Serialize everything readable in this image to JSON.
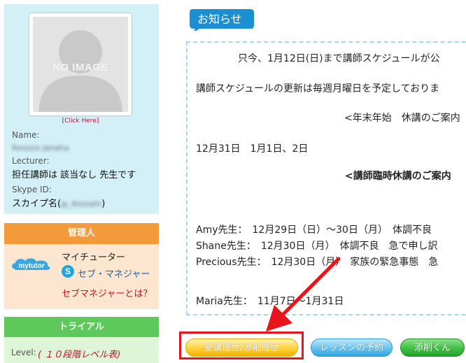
{
  "profile": {
    "noimage": "NO IMAGE",
    "click_here": "[Click Here]",
    "name_label": "Name:",
    "name_value": "Koozzis Janaha",
    "lecturer_label": "Lecturer:",
    "lecturer_value": "担任講師は 該当なし 先生です",
    "skype_label": "Skype ID:",
    "skype_value_prefix": "スカイプ名(",
    "skype_value_blur": "jp_Koozahi",
    "skype_value_suffix": ")"
  },
  "admin": {
    "header": "管理人",
    "logo_text": "mytutor",
    "mytutor_label": "マイチューター",
    "skype_icon": "skype-icon",
    "skype_manager_link": "セブ・マネジャー",
    "what_is_link": "セブマネジャーとは？"
  },
  "trial": {
    "header": "トライアル",
    "level_label": "Level:",
    "level_value": "( １０段階レベル表)"
  },
  "notice": {
    "title": "お知らせ",
    "lines": [
      "只今、1月12日(日)まで講師スケジュールが公",
      "講師スケジュールの更新は毎週月曜日を予定しておりま",
      "<年末年始　休講のご案内",
      "12月31日　1月1日、2日",
      "<講師臨時休講のご案内",
      "Amy先生：　12月29日（日）～30日（月）　体調不良",
      "Shane先生：　12月30日（月）　体調不良　急で申し訳",
      "Precious先生：　12月30日（月）　家族の緊急事態　急",
      "Maria先生：　11月7日～1月31日"
    ]
  },
  "buttons": {
    "history": "受講履歴/添削履歴",
    "lesson_booking": "レッスンの予約",
    "correction": "添削くん"
  },
  "colors": {
    "profile_bg": "#d3f0f8",
    "admin_header": "#f39a3a",
    "trial_header": "#5cc95a",
    "notice_tab": "#1c8fd3",
    "highlight_red": "#e8141c"
  }
}
